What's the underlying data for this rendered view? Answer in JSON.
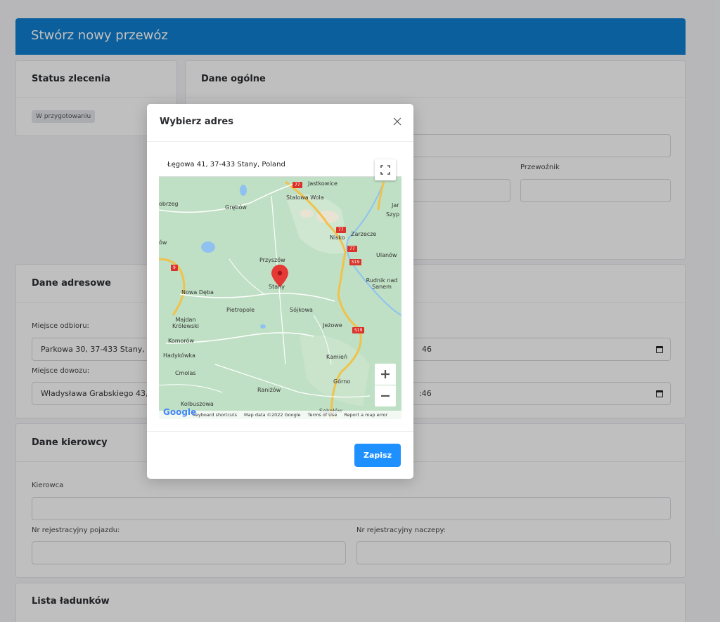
{
  "header": {
    "title": "Stwórz nowy przewóz"
  },
  "status_card": {
    "title": "Status zlecenia",
    "badge": "W przygotowaniu"
  },
  "general_card": {
    "title": "Dane ogólne",
    "carrier_label": "Przewoźnik"
  },
  "address_card": {
    "title": "Dane adresowe",
    "pickup_label": "Miejsce odbioru:",
    "pickup_value": "Parkowa 30, 37-433 Stany, Pol",
    "delivery_label": "Miejsce dowozu:",
    "delivery_value": "Władysława Grabskiego 43,",
    "pickup_date_value": "46",
    "delivery_date_value": ":46"
  },
  "driver_card": {
    "title": "Dane kierowcy",
    "driver_label": "Kierowca",
    "vehicle_reg_label": "Nr rejestracyjny pojazdu:",
    "trailer_reg_label": "Nr rejestracyjny naczepy:"
  },
  "cargo_card": {
    "title": "Lista ładunków"
  },
  "modal": {
    "title": "Wybierz adres",
    "map_address": "Łęgowa 41, 37-433 Stany, Poland",
    "save_label": "Zapisz",
    "google_label": "Google",
    "footer": {
      "shortcuts": "Keyboard shortcuts",
      "mapdata": "Map data ©2022 Google",
      "terms": "Terms of Use",
      "report": "Report a map error"
    },
    "places": [
      "Jastkowice",
      "Stalowa Wola",
      "Grębów",
      "obrzeg",
      "Nisko",
      "Zarzecze",
      "Ulanów",
      "Przyszów",
      "Stany",
      "Rudnik nad Sanem",
      "Nowa Dęba",
      "Pietropole",
      "Sójkowa",
      "Majdan Królewski",
      "Jeżowe",
      "Komorów",
      "Hadykówka",
      "Kamień",
      "Cmolas",
      "Górno",
      "Raniżów",
      "Kolbuszowa",
      "Sokołów",
      "Szyp",
      "Jar",
      "ów"
    ],
    "shields": [
      "77",
      "77",
      "77",
      "9",
      "S19",
      "S19"
    ]
  }
}
